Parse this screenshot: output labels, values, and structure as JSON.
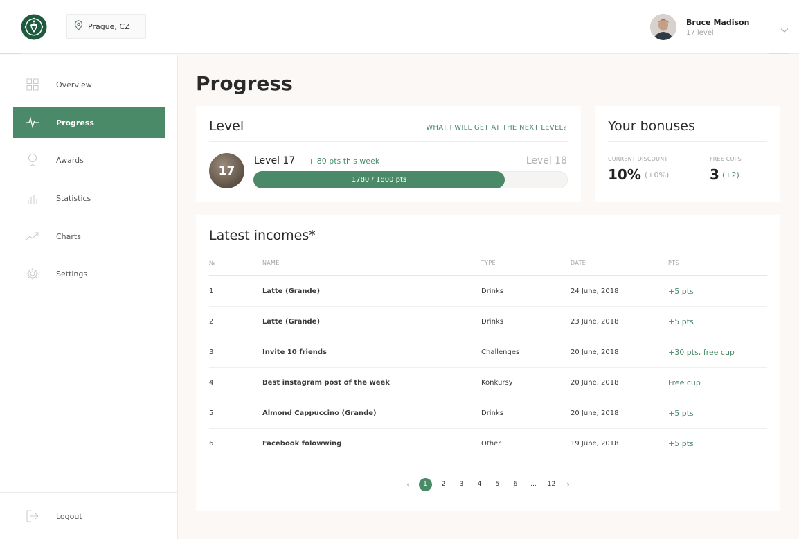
{
  "header": {
    "location": "Prague, CZ",
    "user": {
      "name": "Bruce Madison",
      "level": "17 level"
    }
  },
  "sidebar": {
    "items": [
      {
        "label": "Overview",
        "icon": "grid-icon",
        "active": false
      },
      {
        "label": "Progress",
        "icon": "pulse-icon",
        "active": true
      },
      {
        "label": "Awards",
        "icon": "award-icon",
        "active": false
      },
      {
        "label": "Statistics",
        "icon": "bar-chart-icon",
        "active": false
      },
      {
        "label": "Charts",
        "icon": "trend-icon",
        "active": false
      },
      {
        "label": "Settings",
        "icon": "gear-icon",
        "active": false
      }
    ],
    "logout_label": "Logout"
  },
  "page": {
    "title": "Progress"
  },
  "level_card": {
    "title": "Level",
    "next_level_link": "WHAT I WILL GET AT THE NEXT LEVEL?",
    "badge": "17",
    "current_level": "Level 17",
    "week_points": "+ 80 pts this week",
    "next_level": "Level 18",
    "progress_text": "1780 / 1800 pts",
    "progress_fraction": 0.8
  },
  "bonus_card": {
    "title": "Your bonuses",
    "discount_label": "CURRENT DISCOUNT",
    "discount_value": "10%",
    "discount_delta": "(+0%)",
    "cups_label": "FREE CUPS",
    "cups_value": "3",
    "cups_delta": "(+2)"
  },
  "incomes": {
    "title": "Latest incomes*",
    "columns": [
      "№",
      "NAME",
      "TYPE",
      "DATE",
      "PTS"
    ],
    "rows": [
      {
        "n": "1",
        "name": "Latte (Grande)",
        "type": "Drinks",
        "date": "24 June, 2018",
        "pts": "+5 pts"
      },
      {
        "n": "2",
        "name": "Latte (Grande)",
        "type": "Drinks",
        "date": "23 June, 2018",
        "pts": "+5 pts"
      },
      {
        "n": "3",
        "name": "Invite 10 friends",
        "type": "Challenges",
        "date": "20 June, 2018",
        "pts": "+30 pts, free cup"
      },
      {
        "n": "4",
        "name": "Best instagram post of the week",
        "type": "Konkursy",
        "date": "20 June, 2018",
        "pts": "Free cup"
      },
      {
        "n": "5",
        "name": "Almond Cappuccino (Grande)",
        "type": "Drinks",
        "date": "20 June, 2018",
        "pts": "+5 pts"
      },
      {
        "n": "6",
        "name": "Facebook folowwing",
        "type": "Other",
        "date": "19 June, 2018",
        "pts": "+5 pts"
      }
    ]
  },
  "pagination": {
    "prev": "‹",
    "pages": [
      "1",
      "2",
      "3",
      "4",
      "5",
      "6",
      "...",
      "12"
    ],
    "current": "1",
    "next": "›"
  },
  "colors": {
    "accent": "#4b8a68",
    "background": "#fbf8f6"
  }
}
